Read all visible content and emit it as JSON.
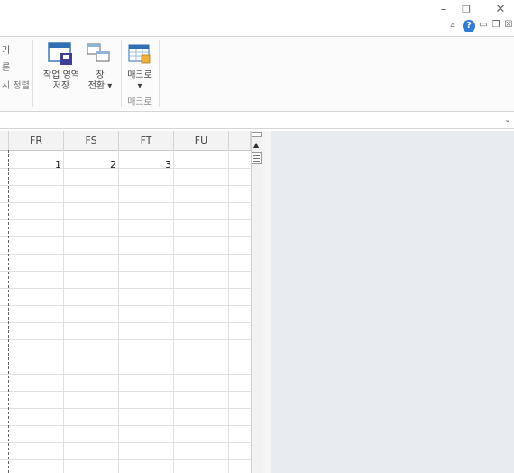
{
  "window": {
    "minimize_glyph": "–",
    "restore_glyph": "❐",
    "close_glyph": "✕",
    "mini": {
      "up_glyph": "▵",
      "help_glyph": "?",
      "min_glyph": "▭",
      "restore_glyph": "❐",
      "close_glyph": "☒"
    }
  },
  "ribbon": {
    "partial_labels": [
      "기",
      "른",
      "시 정렬"
    ],
    "save_workspace": {
      "line1": "작업 영역",
      "line2": "저장"
    },
    "switch_windows": {
      "line1": "창",
      "line2": "전환 ▾"
    },
    "macros": {
      "line1": "매크로",
      "line2": "▾"
    },
    "group_label": "매크로",
    "icons": [
      "save-workspace-icon",
      "switch-windows-icon",
      "macros-icon"
    ]
  },
  "formula_bar": {
    "value": "",
    "dropdown_glyph": "⌄"
  },
  "sheet": {
    "columns": [
      "FR",
      "FS",
      "FT",
      "FU"
    ],
    "row1_values": [
      "1",
      "2",
      "3",
      ""
    ]
  },
  "scrollbar": {
    "up_glyph": "▲"
  },
  "colors": {
    "ribbon_bg": "#fbfbfb",
    "header_bg": "#f3f3f3",
    "gridline": "#e1e1e1",
    "panel_bg": "#e9ecef",
    "help_blue": "#2f7bd8"
  }
}
